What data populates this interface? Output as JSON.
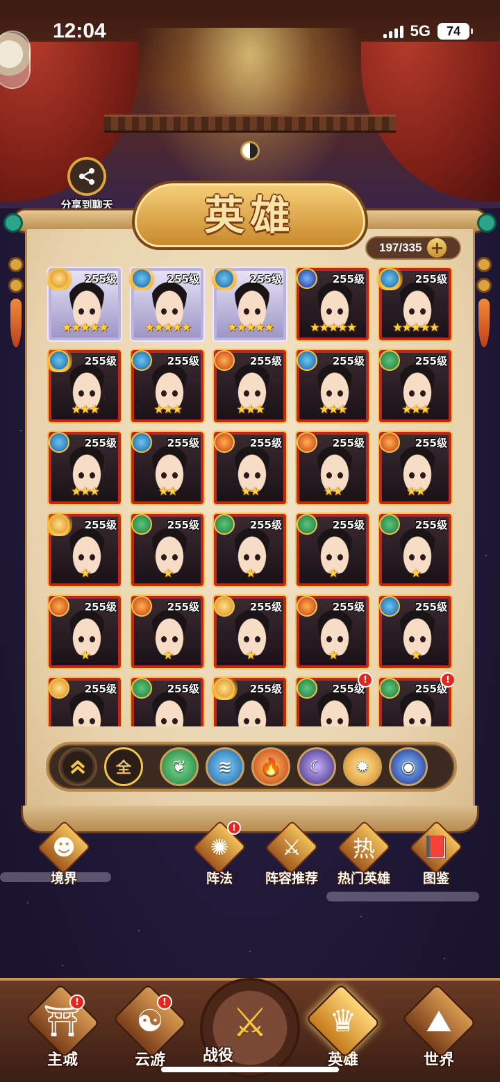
{
  "status_bar": {
    "time": "12:04",
    "network": "5G",
    "battery": "74"
  },
  "share": {
    "label": "分享到聊天",
    "icon": "share-icon"
  },
  "title": "英雄",
  "hero_count": "197/335",
  "heroes": [
    {
      "element": "light",
      "level": "255级",
      "stars": "★★★★★",
      "rarity": "legend",
      "flame": true,
      "alert": false
    },
    {
      "element": "water",
      "level": "255级",
      "stars": "★★★★★",
      "rarity": "legend",
      "flame": true,
      "alert": false
    },
    {
      "element": "water",
      "level": "255级",
      "stars": "★★★★★",
      "rarity": "legend",
      "flame": true,
      "alert": false
    },
    {
      "element": "dark",
      "level": "255级",
      "stars": "★★★★★",
      "rarity": "epic",
      "flame": false,
      "alert": false
    },
    {
      "element": "water",
      "level": "255级",
      "stars": "★★★★★",
      "rarity": "epic",
      "flame": true,
      "alert": false
    },
    {
      "element": "water",
      "level": "255级",
      "stars": "★★★",
      "rarity": "epic",
      "flame": true,
      "alert": false
    },
    {
      "element": "water",
      "level": "255级",
      "stars": "★★★",
      "rarity": "epic",
      "flame": false,
      "alert": false
    },
    {
      "element": "fire",
      "level": "255级",
      "stars": "★★★",
      "rarity": "epic",
      "flame": false,
      "alert": false
    },
    {
      "element": "water",
      "level": "255级",
      "stars": "★★★",
      "rarity": "epic",
      "flame": false,
      "alert": false
    },
    {
      "element": "wood",
      "level": "255级",
      "stars": "★★★",
      "rarity": "epic",
      "flame": false,
      "alert": false
    },
    {
      "element": "water",
      "level": "255级",
      "stars": "★★★",
      "rarity": "epic",
      "flame": false,
      "alert": false
    },
    {
      "element": "water",
      "level": "255级",
      "stars": "★★",
      "rarity": "epic",
      "flame": false,
      "alert": false
    },
    {
      "element": "fire",
      "level": "255级",
      "stars": "★★",
      "rarity": "epic",
      "flame": false,
      "alert": false
    },
    {
      "element": "fire",
      "level": "255级",
      "stars": "★★",
      "rarity": "epic",
      "flame": false,
      "alert": false
    },
    {
      "element": "fire",
      "level": "255级",
      "stars": "★★",
      "rarity": "epic",
      "flame": false,
      "alert": false
    },
    {
      "element": "light",
      "level": "255级",
      "stars": "★",
      "rarity": "epic",
      "flame": true,
      "alert": false
    },
    {
      "element": "wood",
      "level": "255级",
      "stars": "★",
      "rarity": "epic",
      "flame": false,
      "alert": false
    },
    {
      "element": "wood",
      "level": "255级",
      "stars": "★",
      "rarity": "epic",
      "flame": false,
      "alert": false
    },
    {
      "element": "wood",
      "level": "255级",
      "stars": "★",
      "rarity": "epic",
      "flame": false,
      "alert": false
    },
    {
      "element": "wood",
      "level": "255级",
      "stars": "★",
      "rarity": "epic",
      "flame": false,
      "alert": false
    },
    {
      "element": "fire",
      "level": "255级",
      "stars": "★",
      "rarity": "epic",
      "flame": false,
      "alert": false
    },
    {
      "element": "fire",
      "level": "255级",
      "stars": "★",
      "rarity": "epic",
      "flame": false,
      "alert": false
    },
    {
      "element": "light",
      "level": "255级",
      "stars": "★",
      "rarity": "epic",
      "flame": false,
      "alert": false
    },
    {
      "element": "fire",
      "level": "255级",
      "stars": "★",
      "rarity": "epic",
      "flame": false,
      "alert": false
    },
    {
      "element": "water",
      "level": "255级",
      "stars": "★",
      "rarity": "epic",
      "flame": false,
      "alert": false
    },
    {
      "element": "light",
      "level": "255级",
      "stars": "",
      "rarity": "epic",
      "flame": false,
      "alert": false
    },
    {
      "element": "wood",
      "level": "255级",
      "stars": "",
      "rarity": "epic",
      "flame": false,
      "alert": false
    },
    {
      "element": "light",
      "level": "255级",
      "stars": "",
      "rarity": "epic",
      "flame": true,
      "alert": false
    },
    {
      "element": "wood",
      "level": "255级",
      "stars": "",
      "rarity": "epic",
      "flame": false,
      "alert": true
    },
    {
      "element": "wood",
      "level": "255级",
      "stars": "",
      "rarity": "epic",
      "flame": false,
      "alert": true
    }
  ],
  "filters": {
    "collapse_icon": "chevron-up-icon",
    "all_label": "全",
    "elements": [
      {
        "name": "wood",
        "glyph": "❦"
      },
      {
        "name": "water",
        "glyph": "≋"
      },
      {
        "name": "fire",
        "glyph": "🔥"
      },
      {
        "name": "void",
        "glyph": "☾"
      },
      {
        "name": "light",
        "glyph": "✹"
      },
      {
        "name": "dark",
        "glyph": "◉"
      }
    ]
  },
  "actions": [
    {
      "id": "realm",
      "label": "境界",
      "glyph": "☻",
      "alert": false
    },
    {
      "id": "formation",
      "label": "阵法",
      "glyph": "✺",
      "alert": true
    },
    {
      "id": "lineup",
      "label": "阵容推荐",
      "glyph": "⚔",
      "alert": false
    },
    {
      "id": "hot-heroes",
      "label": "热门英雄",
      "glyph": "热",
      "alert": false
    },
    {
      "id": "codex",
      "label": "图鉴",
      "glyph": "📕",
      "alert": false
    }
  ],
  "alert_mark": "!",
  "bottom_nav": [
    {
      "id": "main-city",
      "label": "主城",
      "glyph": "⛩",
      "alert": true,
      "active": false
    },
    {
      "id": "travel",
      "label": "云游",
      "glyph": "☯",
      "alert": true,
      "active": false
    },
    {
      "id": "battle",
      "label": "战役",
      "glyph": "⚔",
      "alert": false,
      "active": false
    },
    {
      "id": "heroes",
      "label": "英雄",
      "glyph": "♛",
      "alert": false,
      "active": true
    },
    {
      "id": "world",
      "label": "世界",
      "glyph": "⛰",
      "alert": false,
      "active": false
    }
  ]
}
